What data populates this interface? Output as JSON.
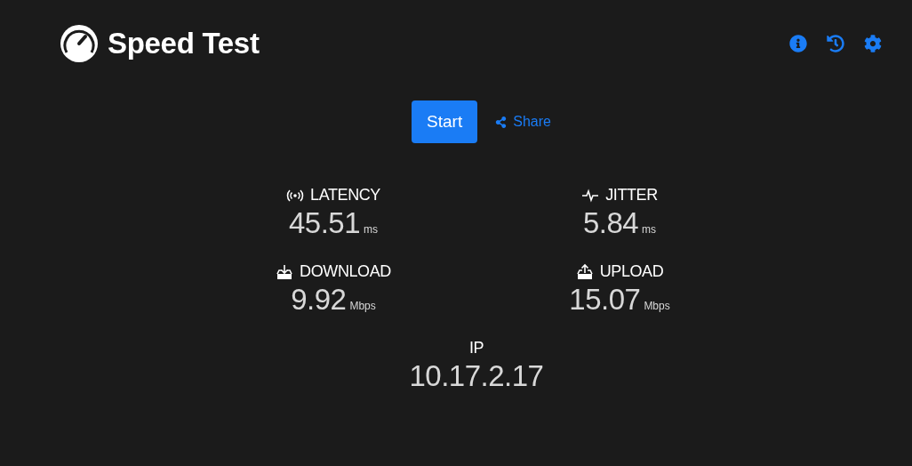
{
  "header": {
    "title": "Speed Test"
  },
  "actions": {
    "start": "Start",
    "share": "Share"
  },
  "metrics": [
    {
      "kind": "latency",
      "label": "LATENCY",
      "value": "45.51",
      "unit": "ms"
    },
    {
      "kind": "jitter",
      "label": "JITTER",
      "value": "5.84",
      "unit": "ms"
    },
    {
      "kind": "download",
      "label": "DOWNLOAD",
      "value": "9.92",
      "unit": "Mbps"
    },
    {
      "kind": "upload",
      "label": "UPLOAD",
      "value": "15.07",
      "unit": "Mbps"
    }
  ],
  "ip": {
    "label": "IP",
    "value": "10.17.2.17"
  }
}
